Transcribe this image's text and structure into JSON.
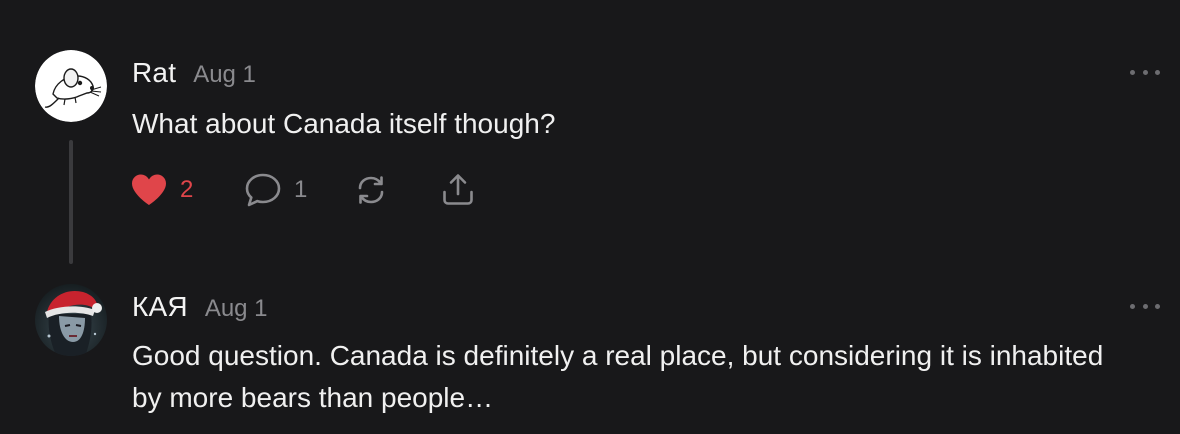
{
  "comments": [
    {
      "author": "Rat",
      "date": "Aug 1",
      "body": "What about Canada itself though?",
      "avatar": "rat-logo-avatar",
      "likes": "2",
      "replies": "1",
      "liked": true
    },
    {
      "author": "КАЯ",
      "date": "Aug 1",
      "body": "Good question. Canada is definitely a real place, but considering it is inhabited by more bears than people…",
      "avatar": "santa-hat-character-avatar"
    }
  ],
  "colors": {
    "background": "#18181a",
    "like_red": "#e0454a",
    "muted": "#8a8a8e"
  },
  "icons": {
    "like": "heart-icon",
    "reply": "comment-bubble-icon",
    "restack": "restack-icon",
    "share": "share-icon",
    "menu": "more-dots-icon"
  }
}
